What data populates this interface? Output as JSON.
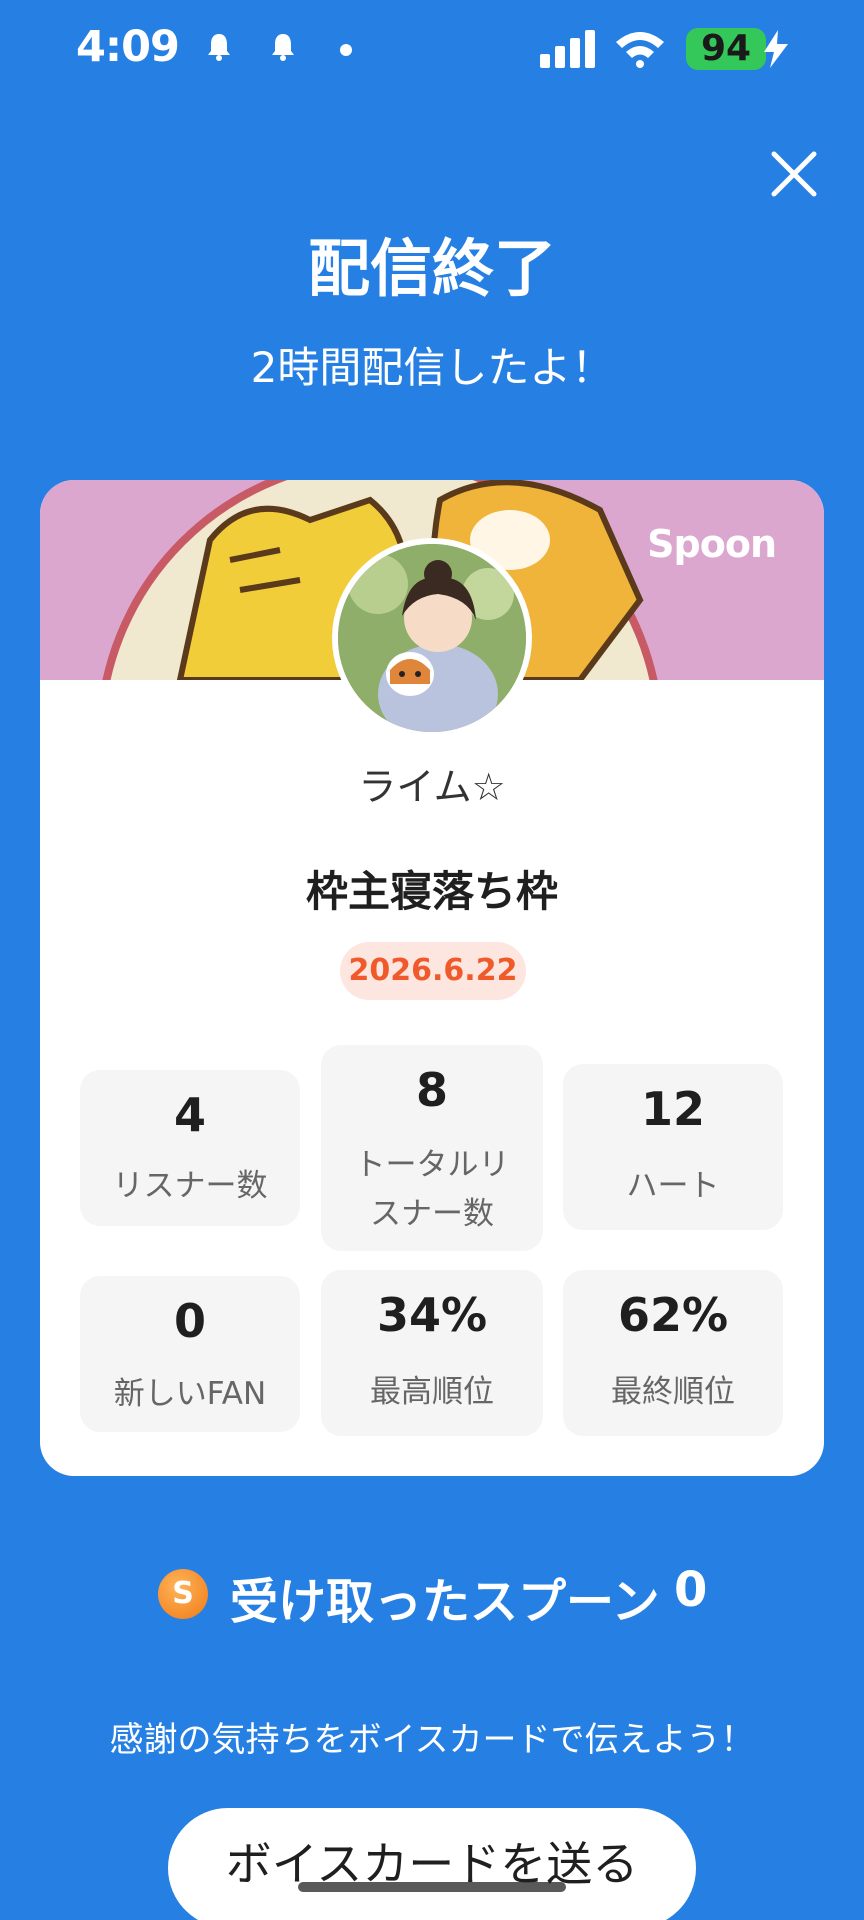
{
  "status_bar": {
    "time": "4:09",
    "battery": "94"
  },
  "header": {
    "title": "配信終了",
    "subtitle": "2時間配信したよ！"
  },
  "card": {
    "brand": "Spoon",
    "host_name": "ライム☆",
    "stream_title": "枠主寝落ち枠",
    "date": "2026.6.22",
    "stats": [
      {
        "value": "4",
        "label": "リスナー数"
      },
      {
        "value": "8",
        "label_line1": "トータルリ",
        "label_line2": "スナー数"
      },
      {
        "value": "12",
        "label": "ハート"
      },
      {
        "value": "0",
        "label": "新しいFAN"
      },
      {
        "value": "34%",
        "label": "最高順位"
      },
      {
        "value": "62%",
        "label": "最終順位"
      }
    ]
  },
  "spoons": {
    "label": "受け取ったスプーン",
    "count": "0",
    "coin_letter": "S"
  },
  "footer": {
    "message": "感謝の気持ちをボイスカードで伝えよう！",
    "button_label": "ボイスカードを送る"
  },
  "colors": {
    "background": "#2680e3",
    "date_badge_text": "#f05a2a",
    "coin": "#f07a14"
  }
}
